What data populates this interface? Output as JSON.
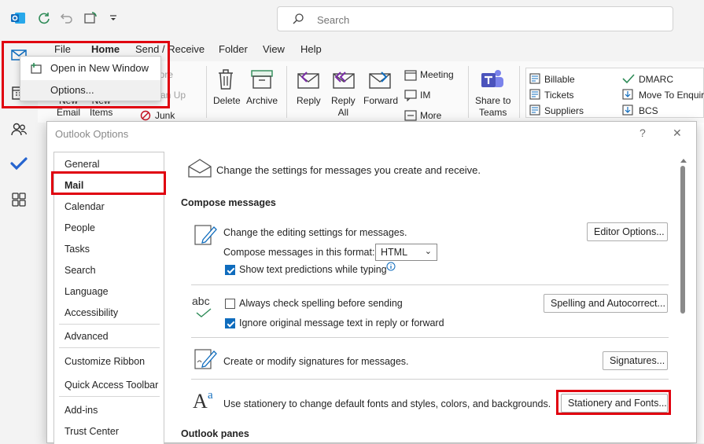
{
  "search": {
    "placeholder": "Search"
  },
  "tabs": [
    "File",
    "Home",
    "Send / Receive",
    "Folder",
    "View",
    "Help"
  ],
  "ribbon": {
    "new_email": "New\nEmail",
    "new_items": "New\nItems",
    "ignore": "Ignore",
    "clean_up": "Clean Up",
    "junk": "Junk",
    "delete": "Delete",
    "archive": "Archive",
    "reply": "Reply",
    "reply_all": "Reply\nAll",
    "forward": "Forward",
    "meeting": "Meeting",
    "im": "IM",
    "more": "More",
    "share_to_teams": "Share to\nTeams",
    "quick_steps": [
      "Billable",
      "Tickets",
      "Suppliers",
      "DMARC",
      "Move To Enquir",
      "BCS"
    ]
  },
  "context_menu": {
    "open_new_window": "Open in New Window",
    "options": "Options..."
  },
  "dialog": {
    "title": "Outlook Options",
    "help": "?",
    "close": "✕",
    "nav": [
      "General",
      "Mail",
      "Calendar",
      "People",
      "Tasks",
      "Search",
      "Language",
      "Accessibility",
      "Advanced",
      "Customize Ribbon",
      "Quick Access Toolbar",
      "Add-ins",
      "Trust Center"
    ],
    "selected_nav": "Mail",
    "header": "Change the settings for messages you create and receive.",
    "compose_section": "Compose messages",
    "editing_text": "Change the editing settings for messages.",
    "editor_options": "Editor Options...",
    "compose_format_label": "Compose messages in this format:",
    "compose_format_value": "HTML",
    "text_predictions": "Show text predictions while typing",
    "text_predictions_checked": true,
    "spell_icon_text": "abc",
    "always_check_spelling": "Always check spelling before sending",
    "always_check_spelling_checked": false,
    "spelling_button": "Spelling and Autocorrect...",
    "ignore_original": "Ignore original message text in reply or forward",
    "ignore_original_checked": true,
    "signatures_text": "Create or modify signatures for messages.",
    "signatures_button": "Signatures...",
    "stationery_text": "Use stationery to change default fonts and styles, colors, and backgrounds.",
    "stationery_button": "Stationery and Fonts...",
    "panes_section": "Outlook panes"
  },
  "colors": {
    "accent": "#0f6cbd",
    "highlight": "#e0000f"
  }
}
